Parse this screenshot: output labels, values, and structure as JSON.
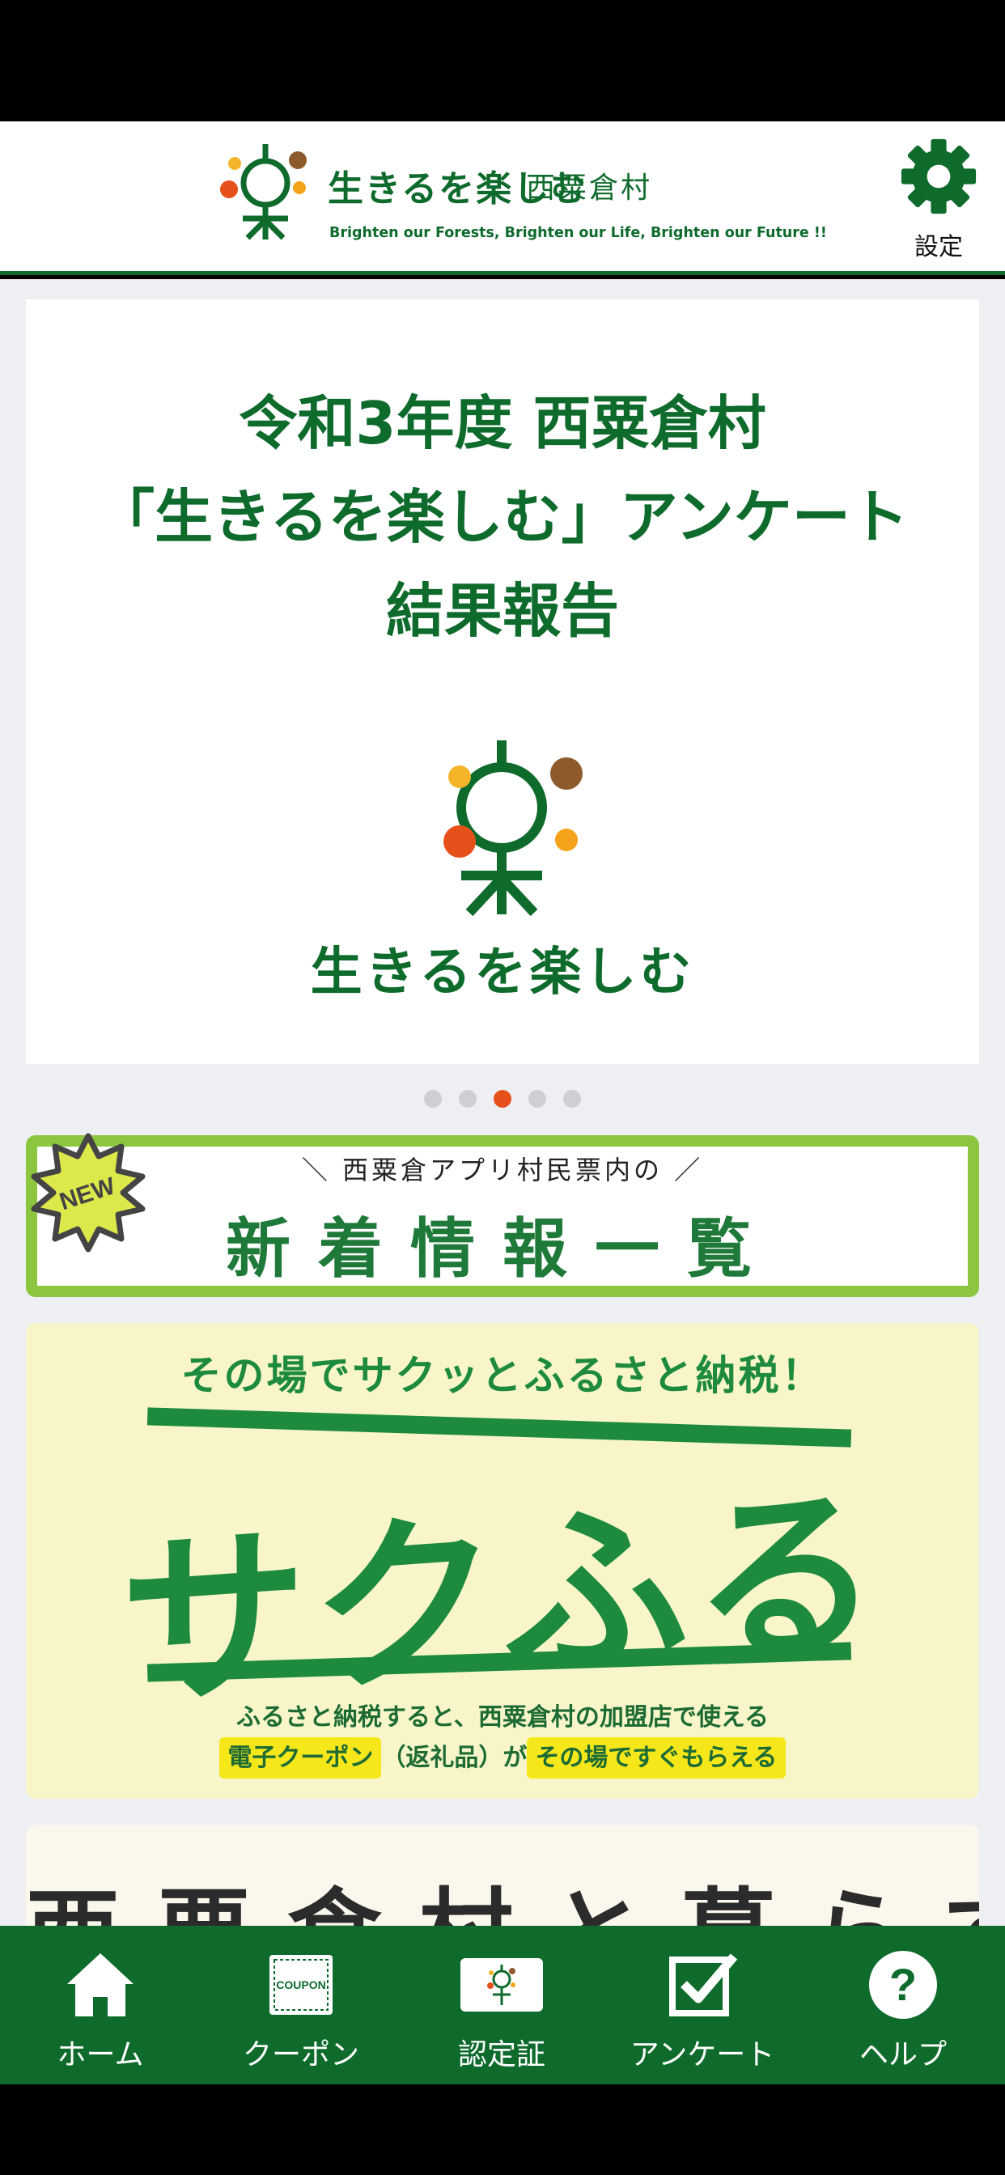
{
  "header": {
    "title": "生きるを楽しむ",
    "subtitle": "西粟倉村",
    "tagline": "Brighten our Forests, Brighten our Life, Brighten our Future !!",
    "settings_label": "設定"
  },
  "hero": {
    "title_line1": "令和3年度 西粟倉村",
    "title_line2": "「生きるを楽しむ」アンケート",
    "title_line3": "結果報告",
    "logo_text": "生きるを楽しむ"
  },
  "carousel": {
    "page_count": 5,
    "current_index": 2
  },
  "news_banner": {
    "badge": "NEW",
    "subtitle": "＼ 西粟倉アプリ村民票内の ／",
    "title": "新着情報一覧"
  },
  "sakufuru": {
    "tagline": "その場でサクッとふるさと納税！",
    "name": "サクふる",
    "desc_line1": "ふるさと納税すると、西粟倉村の加盟店で使える",
    "desc_highlight1": "電子クーポン",
    "desc_middle": "（返礼品）が",
    "desc_highlight2": "その場ですぐもらえる"
  },
  "live_card": {
    "title": "西粟倉村と暮らす"
  },
  "tabbar": {
    "home": "ホーム",
    "coupon": "クーポン",
    "coupon_icon_text": "COUPON",
    "certificate": "認定証",
    "survey": "アンケート",
    "help": "ヘルプ"
  },
  "colors": {
    "primary_green": "#0e6b2c",
    "accent_orange": "#e5501b",
    "lime_border": "#8cc63f",
    "sakufuru_bg": "#f8f6c8",
    "highlight_yellow": "#f6e71a"
  },
  "icons": [
    "logo-mark-icon",
    "gear-icon",
    "new-badge-icon",
    "home-icon",
    "coupon-icon",
    "certificate-icon",
    "checkbox-icon",
    "question-icon"
  ]
}
